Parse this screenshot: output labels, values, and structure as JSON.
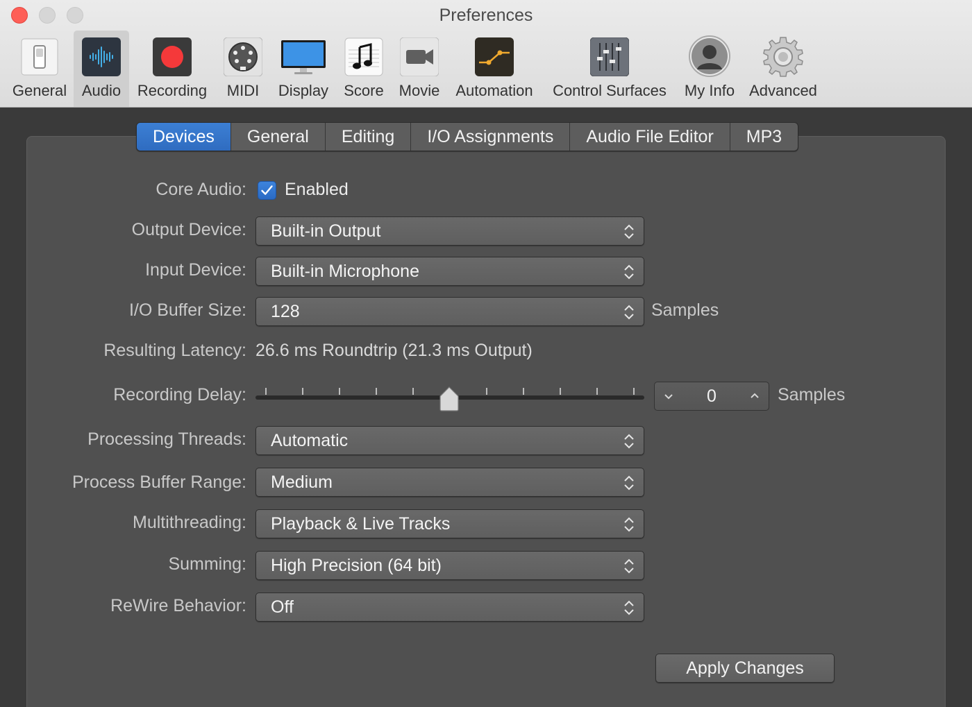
{
  "window": {
    "title": "Preferences"
  },
  "toolbar": {
    "items": [
      {
        "label": "General",
        "icon": "general-switch-icon"
      },
      {
        "label": "Audio",
        "icon": "audio-waveform-icon",
        "selected": true
      },
      {
        "label": "Recording",
        "icon": "record-icon"
      },
      {
        "label": "MIDI",
        "icon": "midi-connector-icon"
      },
      {
        "label": "Display",
        "icon": "display-monitor-icon"
      },
      {
        "label": "Score",
        "icon": "music-note-icon"
      },
      {
        "label": "Movie",
        "icon": "video-camera-icon"
      },
      {
        "label": "Automation",
        "icon": "automation-curve-icon"
      },
      {
        "label": "Control Surfaces",
        "icon": "faders-icon"
      },
      {
        "label": "My Info",
        "icon": "user-silhouette-icon"
      },
      {
        "label": "Advanced",
        "icon": "gear-icon"
      }
    ]
  },
  "tabs": [
    {
      "label": "Devices",
      "active": true
    },
    {
      "label": "General"
    },
    {
      "label": "Editing"
    },
    {
      "label": "I/O Assignments"
    },
    {
      "label": "Audio File Editor"
    },
    {
      "label": "MP3"
    }
  ],
  "form": {
    "core_audio": {
      "label": "Core Audio:",
      "checkbox_label": "Enabled",
      "checked": true
    },
    "output_device": {
      "label": "Output Device:",
      "value": "Built-in Output"
    },
    "input_device": {
      "label": "Input Device:",
      "value": "Built-in Microphone"
    },
    "buffer_size": {
      "label": "I/O Buffer Size:",
      "value": "128",
      "unit": "Samples"
    },
    "latency": {
      "label": "Resulting Latency:",
      "value": "26.6 ms Roundtrip (21.3 ms Output)"
    },
    "recording_delay": {
      "label": "Recording Delay:",
      "value": "0",
      "unit": "Samples",
      "slider_position": 0.5
    },
    "processing_threads": {
      "label": "Processing Threads:",
      "value": "Automatic"
    },
    "process_buffer_range": {
      "label": "Process Buffer Range:",
      "value": "Medium"
    },
    "multithreading": {
      "label": "Multithreading:",
      "value": "Playback & Live Tracks"
    },
    "summing": {
      "label": "Summing:",
      "value": "High Precision (64 bit)"
    },
    "rewire": {
      "label": "ReWire Behavior:",
      "value": "Off"
    }
  },
  "buttons": {
    "apply": "Apply Changes"
  },
  "colors": {
    "accent": "#2f6cc0",
    "record": "#f5393a",
    "close": "#fe5f57"
  }
}
